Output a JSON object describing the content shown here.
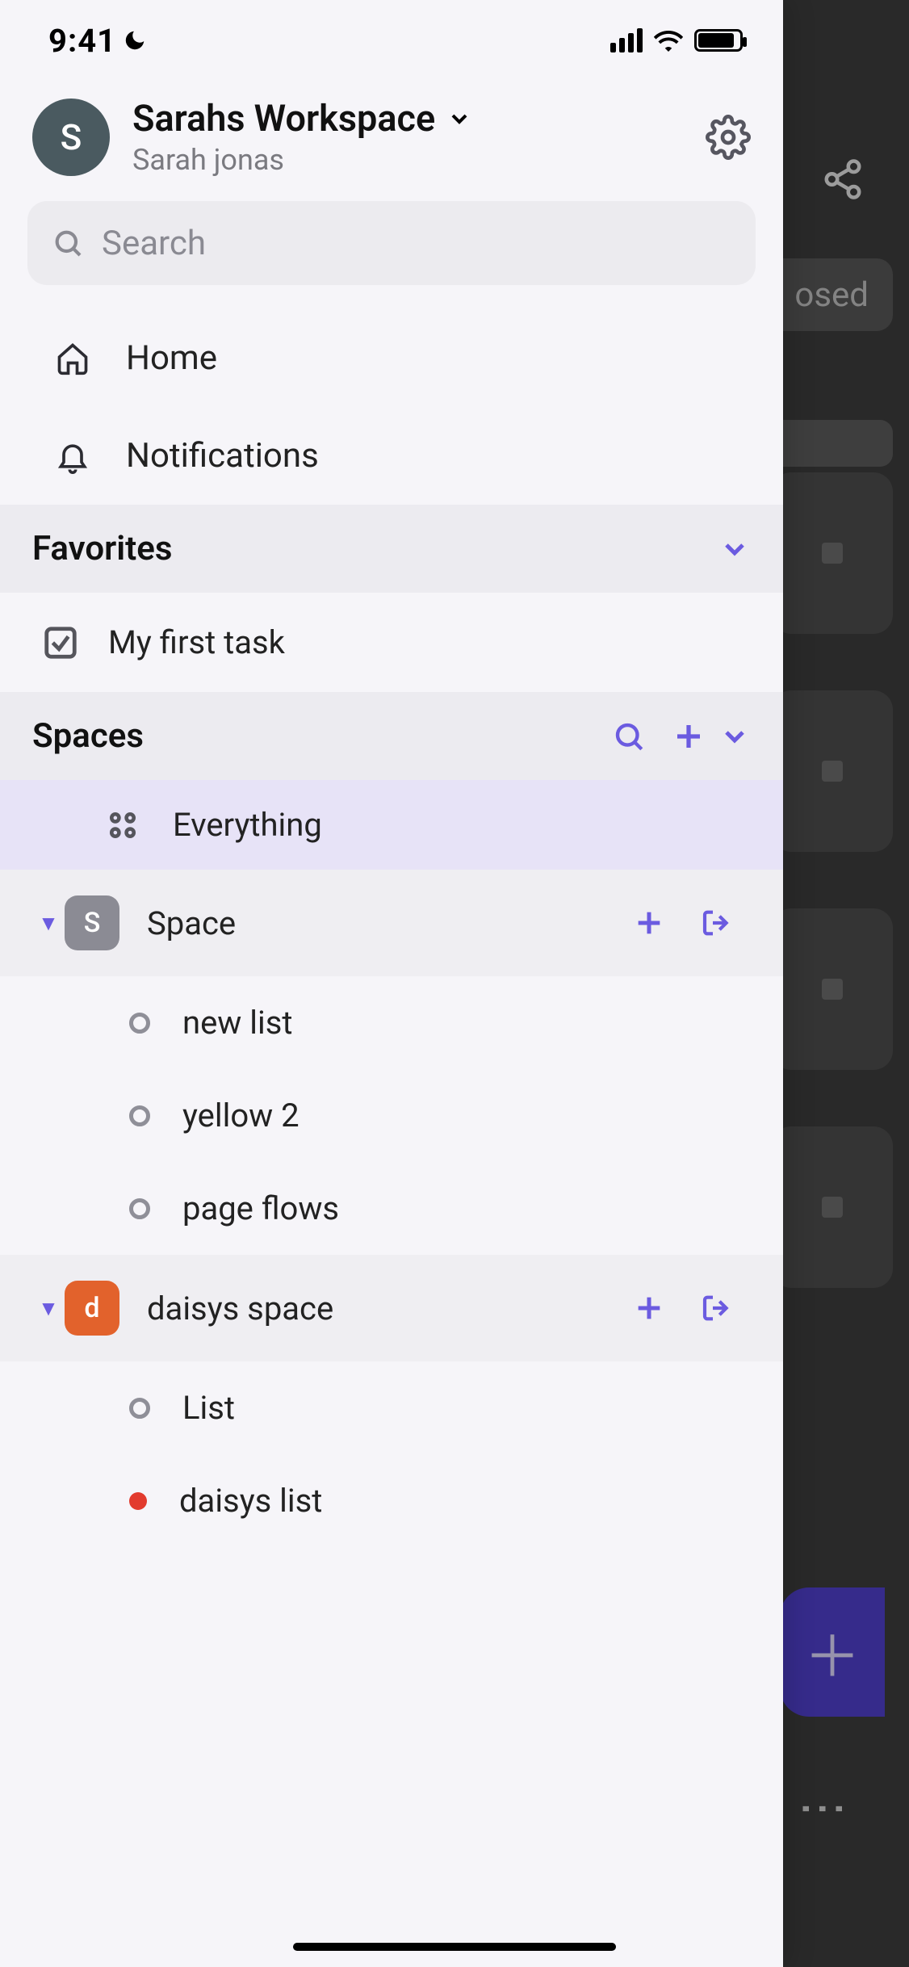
{
  "statusbar": {
    "time": "9:41"
  },
  "workspace": {
    "name": "Sarahs Workspace",
    "user": "Sarah jonas",
    "avatar_initial": "S"
  },
  "search": {
    "placeholder": "Search"
  },
  "nav": {
    "home": "Home",
    "notifications": "Notifications"
  },
  "favorites": {
    "header": "Favorites",
    "items": [
      "My first task"
    ]
  },
  "spaces_section": {
    "header": "Spaces",
    "everything": "Everything",
    "spaces": [
      {
        "name": "Space",
        "initial": "S",
        "color": "#8b8b94",
        "lists": [
          {
            "name": "new list",
            "color": null
          },
          {
            "name": "yellow 2",
            "color": null
          },
          {
            "name": "page flows",
            "color": null
          }
        ]
      },
      {
        "name": "daisys space",
        "initial": "d",
        "color": "#e2622c",
        "lists": [
          {
            "name": "List",
            "color": null
          },
          {
            "name": "daisys list",
            "color": "#e23b2e"
          }
        ]
      }
    ]
  },
  "background": {
    "pill_fragment": "osed"
  }
}
